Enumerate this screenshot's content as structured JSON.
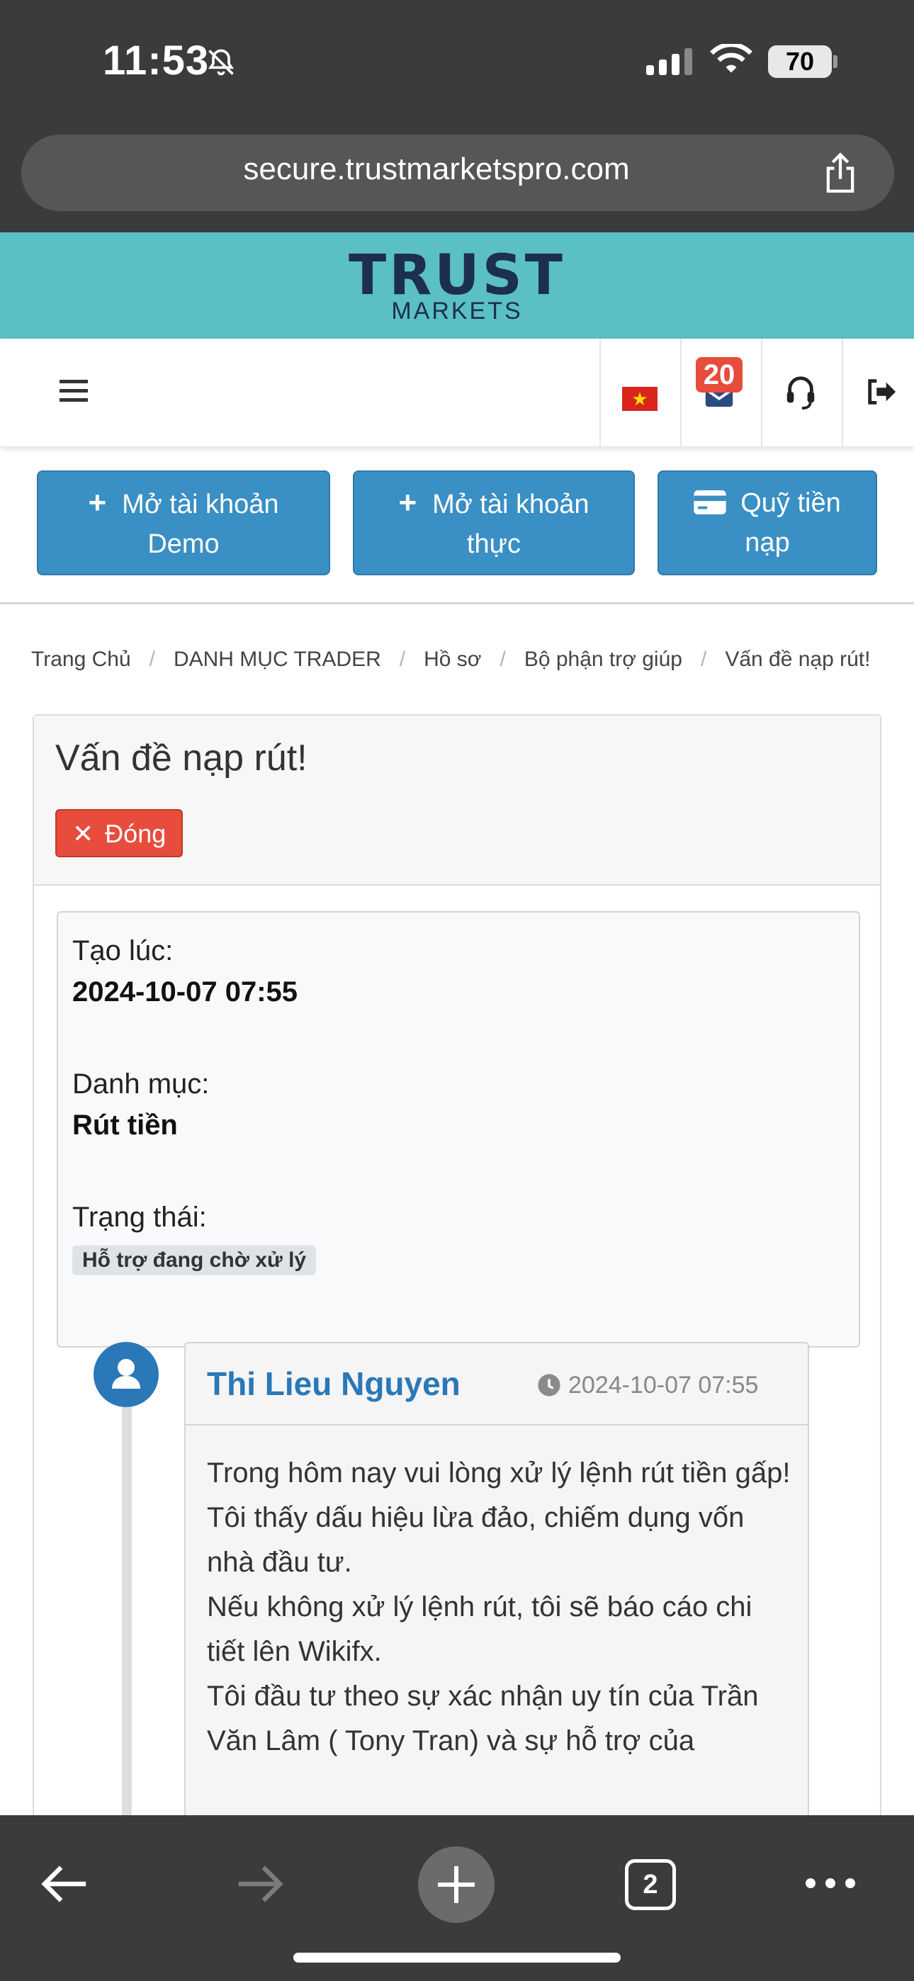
{
  "status_bar": {
    "time": "11:53",
    "battery": "70",
    "icons": [
      "bell-slash-icon",
      "signal-icon",
      "wifi-icon",
      "battery-icon"
    ]
  },
  "browser": {
    "url": "secure.trustmarketspro.com",
    "tab_count": "2",
    "icons": [
      "share-icon",
      "back-icon",
      "forward-icon",
      "new-tab-icon",
      "more-icon"
    ]
  },
  "brand": {
    "logo_main": "TRUST",
    "logo_sub": "MARKETS",
    "header_color": "#5bbfc6"
  },
  "nav": {
    "notification_count": "20",
    "flag_star": "★",
    "icons": [
      "hamburger-icon",
      "vietnam-flag-icon",
      "mail-icon",
      "headset-icon",
      "logout-icon"
    ]
  },
  "actions": {
    "demo_line1": "Mở tài khoản",
    "demo_line2": "Demo",
    "real_line1": "Mở tài khoản",
    "real_line2": "thực",
    "deposit_line1": "Quỹ tiền",
    "deposit_line2": "nạp",
    "plus": "+",
    "button_color": "#3a8fc4"
  },
  "breadcrumb": {
    "items": [
      "Trang Chủ",
      "DANH MỤC TRADER",
      "Hồ sơ",
      "Bộ phận trợ giúp",
      "Vấn đề nạp rút!"
    ],
    "separator": "/"
  },
  "ticket": {
    "title": "Vấn đề nạp rút!",
    "close_label": "Đóng",
    "close_x": "✕",
    "created_label": "Tạo lúc:",
    "created_value": "2024-10-07 07:55",
    "category_label": "Danh mục:",
    "category_value": "Rút tiền",
    "status_label": "Trạng thái:",
    "status_value": "Hỗ trợ đang chờ xử lý"
  },
  "message": {
    "author": "Thi Lieu Nguyen",
    "time": "2024-10-07 07:55",
    "lines": [
      "Trong hôm nay vui lòng xử lý lệnh rút tiền gấp!",
      "Tôi thấy dấu hiệu lừa đảo, chiếm dụng vốn nhà đầu tư.",
      "Nếu không xử lý lệnh rút, tôi sẽ báo cáo chi tiết lên Wikifx.",
      "Tôi đầu tư theo sự xác nhận uy tín của Trần Văn Lâm ( Tony Tran) và sự hỗ trợ của"
    ]
  }
}
